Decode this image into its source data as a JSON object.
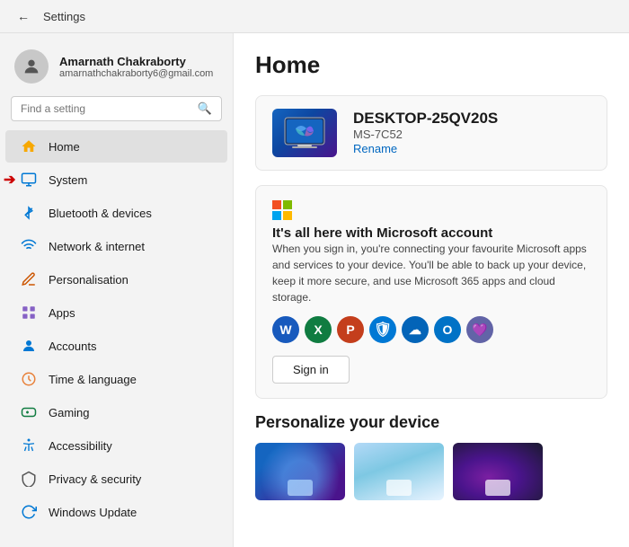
{
  "titlebar": {
    "title": "Settings",
    "back_label": "←"
  },
  "sidebar": {
    "user": {
      "name": "Amarnath Chakraborty",
      "email": "amarnathchakraborty6@gmail.com"
    },
    "search_placeholder": "Find a setting",
    "items": [
      {
        "id": "home",
        "label": "Home",
        "icon": "🏠",
        "class": "home-item",
        "active": true
      },
      {
        "id": "system",
        "label": "System",
        "icon": "🖥",
        "class": "system-item",
        "has_arrow": true
      },
      {
        "id": "bluetooth",
        "label": "Bluetooth & devices",
        "icon": "⬡",
        "class": "bluetooth-item"
      },
      {
        "id": "network",
        "label": "Network & internet",
        "icon": "◈",
        "class": "network-item"
      },
      {
        "id": "personalisation",
        "label": "Personalisation",
        "icon": "✏",
        "class": "personal-item"
      },
      {
        "id": "apps",
        "label": "Apps",
        "icon": "⬛",
        "class": "apps-item"
      },
      {
        "id": "accounts",
        "label": "Accounts",
        "icon": "👤",
        "class": "accounts-item"
      },
      {
        "id": "time",
        "label": "Time & language",
        "icon": "⏱",
        "class": "time-item"
      },
      {
        "id": "gaming",
        "label": "Gaming",
        "icon": "🎮",
        "class": "gaming-item"
      },
      {
        "id": "accessibility",
        "label": "Accessibility",
        "icon": "♿",
        "class": "accessibility-item"
      },
      {
        "id": "privacy",
        "label": "Privacy & security",
        "icon": "🛡",
        "class": "privacy-item"
      },
      {
        "id": "update",
        "label": "Windows Update",
        "icon": "↻",
        "class": "update-item"
      }
    ]
  },
  "main": {
    "title": "Home",
    "device": {
      "name": "DESKTOP-25QV20S",
      "model": "MS-7C52",
      "rename_label": "Rename"
    },
    "ms_card": {
      "title": "It's all here with Microsoft account",
      "description": "When you sign in, you're connecting your favourite Microsoft apps and services to your device. You'll be able to back up your device, keep it more secure, and use Microsoft 365 apps and cloud storage.",
      "signin_label": "Sign in"
    },
    "personalize": {
      "title": "Personalize your device"
    }
  }
}
